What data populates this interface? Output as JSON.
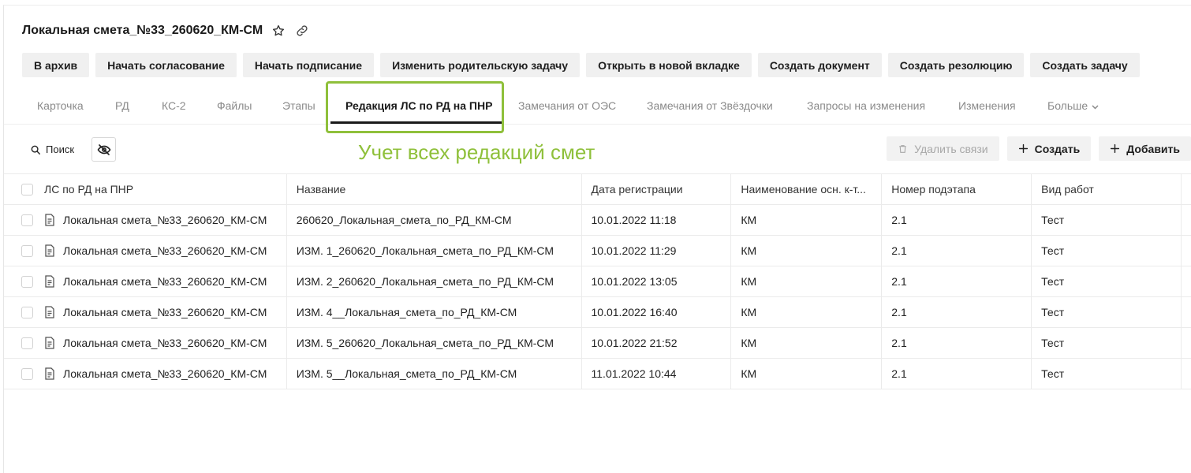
{
  "header": {
    "title": "Локальная смета_№33_260620_КМ-СМ",
    "icons": [
      "star-icon",
      "link-icon"
    ]
  },
  "actions": [
    {
      "label": "В архив"
    },
    {
      "label": "Начать согласование"
    },
    {
      "label": "Начать подписание"
    },
    {
      "label": "Изменить родительскую задачу"
    },
    {
      "label": "Открыть в новой вкладке"
    },
    {
      "label": "Создать документ"
    },
    {
      "label": "Создать резолюцию"
    },
    {
      "label": "Создать задачу"
    }
  ],
  "tabs": [
    {
      "label": "Карточка"
    },
    {
      "label": "РД"
    },
    {
      "label": "КС-2"
    },
    {
      "label": "Файлы"
    },
    {
      "label": "Этапы"
    },
    {
      "label": "Редакция ЛС по РД на ПНР",
      "active": true
    },
    {
      "label": "Замечания от ОЭС"
    },
    {
      "label": "Замечания от Звёздочки"
    },
    {
      "label": "Запросы на изменения"
    },
    {
      "label": "Изменения"
    },
    {
      "label": "Больше"
    }
  ],
  "annotation": "Учет всех редакций смет",
  "toolbar": {
    "search_label": "Поиск",
    "delete_links_label": "Удалить связи",
    "create_label": "Создать",
    "add_label": "Добавить"
  },
  "table": {
    "columns": [
      "ЛС по РД на ПНР",
      "Название",
      "Дата регистрации",
      "Наименование осн. к-т...",
      "Номер подэтапа",
      "Вид работ"
    ],
    "rows": [
      [
        "Локальная смета_№33_260620_КМ-СМ",
        "260620_Локальная_смета_по_РД_КМ-СМ",
        "10.01.2022 11:18",
        "КМ",
        "2.1",
        "Тест"
      ],
      [
        "Локальная смета_№33_260620_КМ-СМ",
        "ИЗМ. 1_260620_Локальная_смета_по_РД_КМ-СМ",
        "10.01.2022 11:29",
        "КМ",
        "2.1",
        "Тест"
      ],
      [
        "Локальная смета_№33_260620_КМ-СМ",
        "ИЗМ. 2_260620_Локальная_смета_по_РД_КМ-СМ",
        "10.01.2022 13:05",
        "КМ",
        "2.1",
        "Тест"
      ],
      [
        "Локальная смета_№33_260620_КМ-СМ",
        "ИЗМ. 4__Локальная_смета_по_РД_КМ-СМ",
        "10.01.2022 16:40",
        "КМ",
        "2.1",
        "Тест"
      ],
      [
        "Локальная смета_№33_260620_КМ-СМ",
        "ИЗМ. 5_260620_Локальная_смета_по_РД_КМ-СМ",
        "10.01.2022 21:52",
        "КМ",
        "2.1",
        "Тест"
      ],
      [
        "Локальная смета_№33_260620_КМ-СМ",
        "ИЗМ. 5__Локальная_смета_по_РД_КМ-СМ",
        "11.01.2022 10:44",
        "КМ",
        "2.1",
        "Тест"
      ]
    ]
  },
  "colors": {
    "accent_highlight": "#8fc03b",
    "button_bg": "#f0f0f0",
    "tab_inactive": "#8a8a8a"
  }
}
